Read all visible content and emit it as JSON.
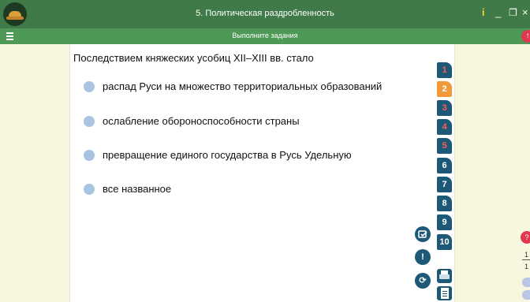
{
  "window": {
    "title": "5. Политическая раздробленность",
    "info_label": "i",
    "minimize_label": "_",
    "maximize_label": "❐",
    "close_label": "×"
  },
  "subbar": {
    "instruction": "Выполните задания",
    "up_label": "↑"
  },
  "question": {
    "text": "Последствием княжеских усобиц XII–XIII вв. стало",
    "options": [
      {
        "label": "распад Руси на множество территориальных образований"
      },
      {
        "label": "ослабление обороноспособности страны"
      },
      {
        "label": "превращение единого государства в Русь Удельную"
      },
      {
        "label": "все названное"
      }
    ]
  },
  "question_tabs": [
    {
      "label": "1",
      "state": "unanswered"
    },
    {
      "label": "2",
      "state": "current"
    },
    {
      "label": "3",
      "state": "unanswered"
    },
    {
      "label": "4",
      "state": "unanswered"
    },
    {
      "label": "5",
      "state": "unanswered"
    },
    {
      "label": "6",
      "state": "done"
    },
    {
      "label": "7",
      "state": "done"
    },
    {
      "label": "8",
      "state": "done"
    },
    {
      "label": "9",
      "state": "done"
    },
    {
      "label": "10",
      "state": "done"
    }
  ],
  "actions": {
    "check_icon": "check-answer-icon",
    "hint_label": "!",
    "reload_label": "⟳",
    "print_icon": "printer-icon",
    "doc_icon": "document-icon"
  },
  "right_panel": {
    "badge_label": "?",
    "num_top": "1",
    "num_bottom": "1"
  },
  "colors": {
    "titlebar": "#3f7a48",
    "subbar": "#4f9957",
    "side_panel": "#f7f7df",
    "tab_blue": "#1e5877",
    "tab_current": "#f29a3a",
    "tab_unanswered_text": "#ff5e57",
    "option_dot": "#a9c4e2"
  }
}
